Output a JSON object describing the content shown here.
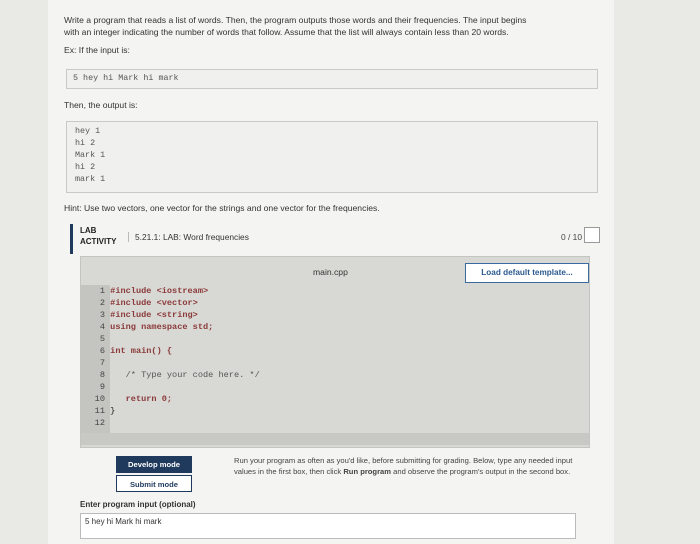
{
  "problem": {
    "intro_line1": "Write a program that reads a list of words. Then, the program outputs those words and their frequencies. The input begins",
    "intro_line2": "with an integer indicating the number of words that follow. Assume that the list will always contain less than 20 words.",
    "example_label": "Ex: If the input is:",
    "example_input": "5 hey hi Mark hi mark",
    "output_label": "Then, the output is:",
    "output_lines": [
      "hey 1",
      "hi 2",
      "Mark 1",
      "hi 2",
      "mark 1"
    ],
    "hint": "Hint: Use two vectors, one vector for the strings and one vector for the frequencies."
  },
  "lab": {
    "tag_line1": "LAB",
    "tag_line2": "ACTIVITY",
    "title": "5.21.1: LAB: Word frequencies",
    "score": "0 / 10"
  },
  "editor": {
    "filename": "main.cpp",
    "load_button": "Load default template...",
    "lines": [
      {
        "num": "1",
        "code": "#include <iostream>"
      },
      {
        "num": "2",
        "code": "#include <vector>"
      },
      {
        "num": "3",
        "code": "#include <string>"
      },
      {
        "num": "4",
        "code": "using namespace std;"
      },
      {
        "num": "5",
        "code": ""
      },
      {
        "num": "6",
        "code": "int main() {"
      },
      {
        "num": "7",
        "code": ""
      },
      {
        "num": "8",
        "code": "   /* Type your code here. */"
      },
      {
        "num": "9",
        "code": ""
      },
      {
        "num": "10",
        "code": "   return 0;"
      },
      {
        "num": "11",
        "code": "}"
      },
      {
        "num": "12",
        "code": ""
      }
    ]
  },
  "run": {
    "develop_button": "Develop mode",
    "submit_button": "Submit mode",
    "info_pre": "Run your program as often as you'd like, before submitting for grading. Below, type any needed input values in the first box, then click ",
    "info_bold": "Run program",
    "info_post": " and observe the program's output in the second box.",
    "input_label": "Enter program input (optional)",
    "input_value": "5 hey hi Mark hi mark"
  }
}
